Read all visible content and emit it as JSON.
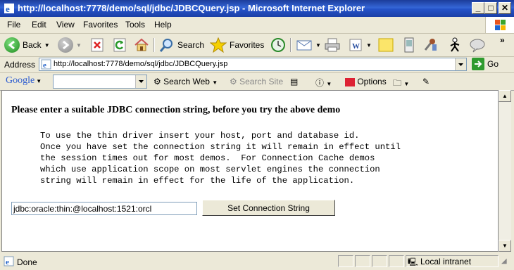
{
  "window": {
    "title": "http://localhost:7778/demo/sql/jdbc/JDBCQuery.jsp - Microsoft Internet Explorer",
    "minimize": "_",
    "maximize": "□",
    "close": "✕"
  },
  "menu": [
    "File",
    "Edit",
    "View",
    "Favorites",
    "Tools",
    "Help"
  ],
  "toolbar": {
    "back": "Back",
    "search": "Search",
    "favorites": "Favorites",
    "chevron": "»"
  },
  "address": {
    "label": "Address",
    "url": "http://localhost:7778/demo/sql/jdbc/JDBCQuery.jsp",
    "go": "Go"
  },
  "google": {
    "logo": "Google",
    "search_web": "Search Web",
    "search_site": "Search Site",
    "options": "Options"
  },
  "page": {
    "heading": "Please enter a suitable JDBC connection string, before you try the above demo",
    "instructions": "To use the thin driver insert your host, port and database id.\nOnce you have set the connection string it will remain in effect until\nthe session times out for most demos.  For Connection Cache demos\nwhich use application scope on most servlet engines the connection\nstring will remain in effect for the life of the application.",
    "connection_string": "jdbc:oracle:thin:@localhost:1521:orcl",
    "set_button": "Set Connection String"
  },
  "status": {
    "text": "Done",
    "zone": "Local intranet"
  }
}
